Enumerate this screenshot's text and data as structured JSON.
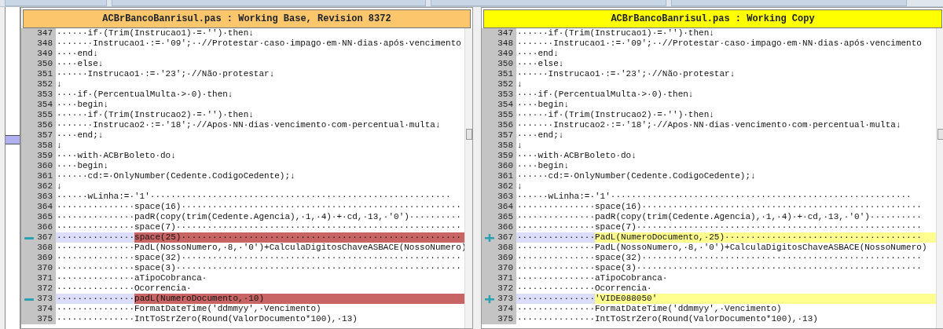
{
  "panes": [
    {
      "title": "ACBrBancoBanrisul.pas : Working Base, Revision 8372",
      "kind": "base",
      "lines": [
        {
          "num": "347",
          "kind": "normal",
          "text": "······if·(Trim(Instrucao1)·=·'')·then↓"
        },
        {
          "num": "348",
          "kind": "normal",
          "text": "·······Instrucao1·:=·'09';··//Protestar·caso·impago·em·NN·dias·após·vencimento"
        },
        {
          "num": "349",
          "kind": "normal",
          "text": "····end↓"
        },
        {
          "num": "350",
          "kind": "normal",
          "text": "····else↓"
        },
        {
          "num": "351",
          "kind": "normal",
          "text": "······Instrucao1·:=·'23';·//Não·protestar↓"
        },
        {
          "num": "352",
          "kind": "normal",
          "text": "↓"
        },
        {
          "num": "353",
          "kind": "normal",
          "text": "····if·(PercentualMulta·>·0)·then↓"
        },
        {
          "num": "354",
          "kind": "normal",
          "text": "····begin↓"
        },
        {
          "num": "355",
          "kind": "normal",
          "text": "······if·(Trim(Instrucao2)·=·'')·then↓"
        },
        {
          "num": "356",
          "kind": "normal",
          "text": "·······Instrucao2·:=·'18';·//Apos·NN·dias·vencimento·com·percentual·multa↓"
        },
        {
          "num": "357",
          "kind": "normal",
          "text": "····end;↓"
        },
        {
          "num": "358",
          "kind": "normal",
          "text": "↓"
        },
        {
          "num": "359",
          "kind": "normal",
          "text": "····with·ACBrBoleto·do↓"
        },
        {
          "num": "360",
          "kind": "normal",
          "text": "····begin↓"
        },
        {
          "num": "361",
          "kind": "normal",
          "text": "······cd:=·OnlyNumber(Cedente.CodigoCedente);↓"
        },
        {
          "num": "362",
          "kind": "normal",
          "text": "↓"
        },
        {
          "num": "363",
          "kind": "normal",
          "text": "······wLinha:=·'1'··························································"
        },
        {
          "num": "364",
          "kind": "normal",
          "text": "···············space(16)······················································"
        },
        {
          "num": "365",
          "kind": "normal",
          "text": "···············padR(copy(trim(Cedente.Agencia),·1,·4)·+·cd,·13,·'0')··········"
        },
        {
          "num": "366",
          "kind": "normal",
          "text": "···············space(7)·······················································"
        },
        {
          "num": "367",
          "kind": "removed",
          "indent": "···············",
          "text": "space(25)······················································"
        },
        {
          "num": "368",
          "kind": "normal",
          "text": "···············PadL(NossoNumero,·8,·'0')+CalculaDigitosChaveASBACE(NossoNumero)"
        },
        {
          "num": "369",
          "kind": "normal",
          "text": "···············space(32)······················································"
        },
        {
          "num": "370",
          "kind": "normal",
          "text": "···············space(3)·······················································"
        },
        {
          "num": "371",
          "kind": "normal",
          "text": "···············aTipoCobranca·"
        },
        {
          "num": "372",
          "kind": "normal",
          "text": "···············Ocorrencia·"
        },
        {
          "num": "373",
          "kind": "removed",
          "indent": "···············",
          "text": "padL(NumeroDocumento,·10)"
        },
        {
          "num": "374",
          "kind": "normal",
          "text": "···············FormatDateTime('ddmmyy',·Vencimento)"
        },
        {
          "num": "375",
          "kind": "normal",
          "text": "···············IntToStrZero(Round(ValorDocumento*100),·13)"
        }
      ]
    },
    {
      "title": "ACBrBancoBanrisul.pas : Working Copy",
      "kind": "working",
      "lines": [
        {
          "num": "347",
          "kind": "normal",
          "text": "······if·(Trim(Instrucao1)·=·'')·then↓"
        },
        {
          "num": "348",
          "kind": "normal",
          "text": "·······Instrucao1·:=·'09';··//Protestar·caso·impago·em·NN·dias·após·vencimento"
        },
        {
          "num": "349",
          "kind": "normal",
          "text": "····end↓"
        },
        {
          "num": "350",
          "kind": "normal",
          "text": "····else↓"
        },
        {
          "num": "351",
          "kind": "normal",
          "text": "······Instrucao1·:=·'23';·//Não·protestar↓"
        },
        {
          "num": "352",
          "kind": "normal",
          "text": "↓"
        },
        {
          "num": "353",
          "kind": "normal",
          "text": "····if·(PercentualMulta·>·0)·then↓"
        },
        {
          "num": "354",
          "kind": "normal",
          "text": "····begin↓"
        },
        {
          "num": "355",
          "kind": "normal",
          "text": "······if·(Trim(Instrucao2)·=·'')·then↓"
        },
        {
          "num": "356",
          "kind": "normal",
          "text": "·······Instrucao2·:=·'18';·//Apos·NN·dias·vencimento·com·percentual·multa↓"
        },
        {
          "num": "357",
          "kind": "normal",
          "text": "····end;↓"
        },
        {
          "num": "358",
          "kind": "normal",
          "text": "↓"
        },
        {
          "num": "359",
          "kind": "normal",
          "text": "····with·ACBrBoleto·do↓"
        },
        {
          "num": "360",
          "kind": "normal",
          "text": "····begin↓"
        },
        {
          "num": "361",
          "kind": "normal",
          "text": "······cd:=·OnlyNumber(Cedente.CodigoCedente);↓"
        },
        {
          "num": "362",
          "kind": "normal",
          "text": "↓"
        },
        {
          "num": "363",
          "kind": "normal",
          "text": "······wLinha:=·'1'··························································"
        },
        {
          "num": "364",
          "kind": "normal",
          "text": "···············space(16)······················································"
        },
        {
          "num": "365",
          "kind": "normal",
          "text": "···············padR(copy(trim(Cedente.Agencia),·1,·4)·+·cd,·13,·'0')··········"
        },
        {
          "num": "366",
          "kind": "normal",
          "text": "···············space(7)·······················································"
        },
        {
          "num": "367",
          "kind": "added",
          "indent": "···············",
          "text": "PadL(NumeroDocumento,·25)······································"
        },
        {
          "num": "368",
          "kind": "normal",
          "text": "···············PadL(NossoNumero,·8,·'0')+CalculaDigitosChaveASBACE(NossoNumero)"
        },
        {
          "num": "369",
          "kind": "normal",
          "text": "···············space(32)······················································"
        },
        {
          "num": "370",
          "kind": "normal",
          "text": "···············space(3)·······················································"
        },
        {
          "num": "371",
          "kind": "normal",
          "text": "···············aTipoCobranca·"
        },
        {
          "num": "372",
          "kind": "normal",
          "text": "···············Ocorrencia·"
        },
        {
          "num": "373",
          "kind": "added",
          "indent": "···············",
          "text": "'VIDE088050'"
        },
        {
          "num": "374",
          "kind": "normal",
          "text": "···············FormatDateTime('ddmmyy',·Vencimento)"
        },
        {
          "num": "375",
          "kind": "normal",
          "text": "···············IntToStrZero(Round(ValorDocumento*100),·13)"
        }
      ]
    }
  ]
}
